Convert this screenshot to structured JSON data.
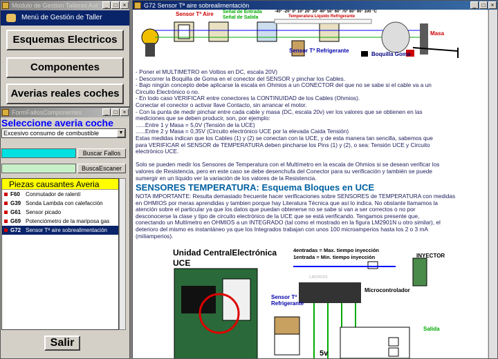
{
  "menu_window": {
    "title": "Modulo de Gestion Talleres Aut",
    "header": "Menú de Gestión de Taller",
    "buttons": [
      "Esquemas Electricos",
      "Componentes",
      "Averias reales coches"
    ]
  },
  "fallos_window": {
    "title": "FormFallosComponentes",
    "select_label": "Seleccione averia coche",
    "selected_fault": "Excesivo consumo de combustible",
    "search_faults_button": "Buscar Fallos",
    "search_scanner_button": "BuscaEscaner",
    "list_header": "Piezas causantes Averia",
    "items": [
      {
        "code": "F60",
        "name": "Conmutador de ralentí",
        "selected": false
      },
      {
        "code": "G39",
        "name": "Sonda Lambda con calefacción",
        "selected": false
      },
      {
        "code": "G61",
        "name": "Sensor picado",
        "selected": false
      },
      {
        "code": "G69",
        "name": "Potenciómetro de la mariposa gas",
        "selected": false
      },
      {
        "code": "G72",
        "name": "Sensor Tª aire sobrealimentación",
        "selected": true
      }
    ],
    "exit_button": "Salir"
  },
  "content_window": {
    "title": "G72  Sensor Tª aire sobrealimentación",
    "diagram_top": {
      "sensor_aire": "Sensor Tª Aire",
      "senal_entrada": "Señal de Entrada",
      "senal_salida": "Señal de Salida",
      "sensor_refrigerante": "Sensor Tª Refrigerante",
      "temp_liquido": "Temperatura Liquido Refrigerante",
      "boquilla_goma": "Boquilla Goma",
      "masa": "Masa",
      "scale": "-40° -20° 0° 10° 20° 30° 40° 50° 60° 70° 80° 90° 100 °C"
    },
    "paragraphs": [
      "- Poner el MULTIMETRO en Voltios en DC, escala 20V)",
      "- Descorrer la Boquilla de Goma en el conector del SENSOR y pinchar los Cables.",
      "- Bajo ningún concepto debe aplicarse la escala en Ohmios a un CONECTOR del que no se sabe si el cable va a un",
      "Circuito Electrónico o no.",
      "- En todo caso VERIFICAR entre conectores la CONTINUIDAD de los Cables (Ohmios).",
      "Conectar el conector o activar llave Contacto, sin arrancar el motor.",
      "- Con la punta de medir pinchar entre cada cable y masa (DC, escala 20v) ver los valores que se obtienen en las",
      "mediciones que se deben producir, son, por ejemplo:",
      "......Entre 1 y Masa = 5,0V (Tensión de la UCE)",
      "......Entre 2 y Masa = 0,35V (Circuito electrónico UCE por la elevada Caida Tensión)",
      "Estas medidas indican que los Cables (1) y (2) se conectan con la UCE, y de esta manera tan sencilla, sabemos que",
      "para VERIFICAR el SENSOR de TEMPERATURA deben pincharse los Pins (1) y (2), o sea: Tensión UCE y Circuito",
      "electrónico UCE.",
      "",
      "Solo se pueden medir los Sensores de Temperatura con el Multímetro en la escala de Ohmios si se desean verificar los",
      "valores de Resistencia, pero en este caso se debe desenchufa del Conector para su verificación y también se puede",
      "sumergir en un líquido ver la variación de los valores de la Resistencia."
    ],
    "section_title": "SENSORES TEMPERATURA: Esquema Bloques en UCE",
    "paragraphs2": [
      "NOTA IMPORTANTE: Resulta demasiado frecuente hacer verificaciones sobre SENSORES de TEMPERATURA con medidas",
      "en OHMIOS por meras aprendidas y tambien porque hay Literatura Técnica que así lo indica. No obstante llamamos la",
      "atención sobre el particular ya que los datos que puedan obtenerse no se sabe si van a ser correctos o no por",
      "desconocerse la clase y tipo de circuito electrónico de la UCE que se está verificando. Tengamos presente que,",
      "conectando un Multímetro en OHMIOS a un INTEGRADO (tal como el mostrado en la figura LM2901N u otro similar), el",
      "deterioro del mismo es instantáneo ya que los Integrados trabajan con unos 100 microamperios hasta los 2 o 3 mA",
      "(miliamperios)."
    ],
    "diagram_bottom": {
      "uce_title": "Unidad CentralElectrónica",
      "uce": "UCE",
      "entradas4": "4entradas = Max. tiempo inyección",
      "entrada1": "1entrada  = Min. tiempo inyección",
      "inyector": "INYECTOR",
      "microcontrolador": "Microcontrolador",
      "sensor_refrigerante": "Sensor Tª Refrigerante",
      "chip_label": "LM2901N",
      "vcc": "5v",
      "salida": "Salida"
    }
  }
}
